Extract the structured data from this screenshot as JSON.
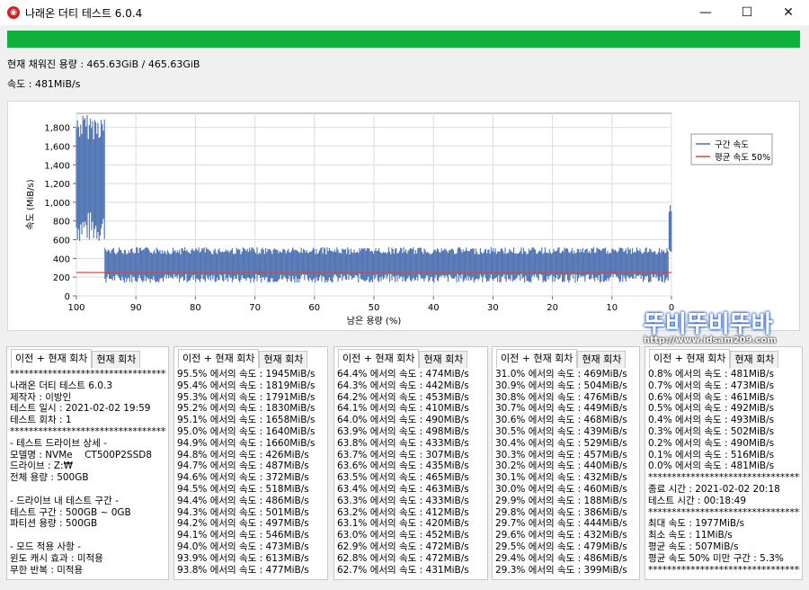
{
  "window": {
    "title": "나래온 더티 테스트 6.0.4",
    "minimize": "—",
    "maximize": "☐",
    "close": "✕"
  },
  "progress": {
    "percent": 100,
    "color": "#0fb13a"
  },
  "status": {
    "filled": "현재 채워진 용량 : 465.63GiB / 465.63GiB",
    "speed": "속도 : 481MiB/s"
  },
  "chart_data": {
    "type": "line",
    "title": "",
    "xlabel": "남은 용량 (%)",
    "ylabel": "속도 (MiB/s)",
    "x_ticks": [
      "100",
      "90",
      "80",
      "70",
      "60",
      "50",
      "40",
      "30",
      "20",
      "10",
      "0"
    ],
    "y_ticks": [
      "0",
      "200",
      "400",
      "600",
      "800",
      "1,000",
      "1,200",
      "1,400",
      "1,600",
      "1,800"
    ],
    "xlim": [
      100,
      0
    ],
    "ylim": [
      0,
      1950
    ],
    "grid": true,
    "legend_position": "top-right",
    "series": [
      {
        "name": "구간 속도",
        "color": "#4a6fb0",
        "segments": [
          {
            "x_from": 100,
            "x_to": 95.2,
            "low": 560,
            "high": 1945
          },
          {
            "x_from": 95.2,
            "x_to": 0.4,
            "low": 140,
            "high": 520
          },
          {
            "x_from": 0.4,
            "x_to": 0,
            "low": 450,
            "high": 1000
          }
        ]
      },
      {
        "name": "평균 속도 50%",
        "color": "#d64545",
        "value": 250
      }
    ]
  },
  "watermark": {
    "big": "뚜비뚜비뚜바",
    "small": "http://www.idsam209.com"
  },
  "panels": [
    {
      "tab_active": "이전 + 현재 회차",
      "tab_other": "현재 회차",
      "text": "*****************************************\n나래온 더티 테스트 6.0.3\n제작자 : 이방인\n테스트 일시 : 2021-02-02 19:59\n테스트 회차 : 1\n*****************************************\n- 테스트 드라이브 상세 -\n모델명 : NVMe    CT500P2SSD8\n드라이브 : Z:₩\n전체 용량 : 500GB\n\n- 드라이브 내 테스트 구간 -\n테스트 구간 : 500GB ~ 0GB\n파티션 용량 : 500GB\n\n- 모드 적용 사항 -\n윈도 캐시 효과 : 미적용\n무한 반복 : 미적용"
    },
    {
      "tab_active": "이전 + 현재 회차",
      "tab_other": "현재 회차",
      "text": "95.5% 에서의 속도 : 1945MiB/s\n95.4% 에서의 속도 : 1819MiB/s\n95.3% 에서의 속도 : 1791MiB/s\n95.2% 에서의 속도 : 1830MiB/s\n95.1% 에서의 속도 : 1658MiB/s\n95.0% 에서의 속도 : 1640MiB/s\n94.9% 에서의 속도 : 1660MiB/s\n94.8% 에서의 속도 : 426MiB/s\n94.7% 에서의 속도 : 487MiB/s\n94.6% 에서의 속도 : 372MiB/s\n94.5% 에서의 속도 : 518MiB/s\n94.4% 에서의 속도 : 486MiB/s\n94.3% 에서의 속도 : 501MiB/s\n94.2% 에서의 속도 : 497MiB/s\n94.1% 에서의 속도 : 546MiB/s\n94.0% 에서의 속도 : 473MiB/s\n93.9% 에서의 속도 : 613MiB/s\n93.8% 에서의 속도 : 477MiB/s"
    },
    {
      "tab_active": "이전 + 현재 회차",
      "tab_other": "현재 회차",
      "text": "64.4% 에서의 속도 : 474MiB/s\n64.3% 에서의 속도 : 442MiB/s\n64.2% 에서의 속도 : 453MiB/s\n64.1% 에서의 속도 : 410MiB/s\n64.0% 에서의 속도 : 490MiB/s\n63.9% 에서의 속도 : 498MiB/s\n63.8% 에서의 속도 : 433MiB/s\n63.7% 에서의 속도 : 307MiB/s\n63.6% 에서의 속도 : 435MiB/s\n63.5% 에서의 속도 : 465MiB/s\n63.4% 에서의 속도 : 463MiB/s\n63.3% 에서의 속도 : 433MiB/s\n63.2% 에서의 속도 : 412MiB/s\n63.1% 에서의 속도 : 420MiB/s\n63.0% 에서의 속도 : 452MiB/s\n62.9% 에서의 속도 : 472MiB/s\n62.8% 에서의 속도 : 472MiB/s\n62.7% 에서의 속도 : 431MiB/s"
    },
    {
      "tab_active": "이전 + 현재 회차",
      "tab_other": "현재 회차",
      "text": "31.0% 에서의 속도 : 469MiB/s\n30.9% 에서의 속도 : 504MiB/s\n30.8% 에서의 속도 : 476MiB/s\n30.7% 에서의 속도 : 449MiB/s\n30.6% 에서의 속도 : 468MiB/s\n30.5% 에서의 속도 : 439MiB/s\n30.4% 에서의 속도 : 529MiB/s\n30.3% 에서의 속도 : 457MiB/s\n30.2% 에서의 속도 : 440MiB/s\n30.1% 에서의 속도 : 432MiB/s\n30.0% 에서의 속도 : 460MiB/s\n29.9% 에서의 속도 : 188MiB/s\n29.8% 에서의 속도 : 386MiB/s\n29.7% 에서의 속도 : 444MiB/s\n29.6% 에서의 속도 : 432MiB/s\n29.5% 에서의 속도 : 479MiB/s\n29.4% 에서의 속도 : 486MiB/s\n29.3% 에서의 속도 : 399MiB/s"
    },
    {
      "tab_active": "이전 + 현재 회차",
      "tab_other": "현재 회차",
      "text": "0.8% 에서의 속도 : 481MiB/s\n0.7% 에서의 속도 : 473MiB/s\n0.6% 에서의 속도 : 461MiB/s\n0.5% 에서의 속도 : 492MiB/s\n0.4% 에서의 속도 : 493MiB/s\n0.3% 에서의 속도 : 502MiB/s\n0.2% 에서의 속도 : 490MiB/s\n0.1% 에서의 속도 : 516MiB/s\n0.0% 에서의 속도 : 481MiB/s\n*****************************************\n종료 시간 : 2021-02-02 20:18\n테스트 시간 : 00:18:49\n*****************************************\n최대 속도 : 1977MiB/s\n최소 속도 : 11MiB/s\n평균 속도 : 507MiB/s\n평균 속도 50% 미만 구간 : 5.3%\n*****************************************"
    }
  ]
}
